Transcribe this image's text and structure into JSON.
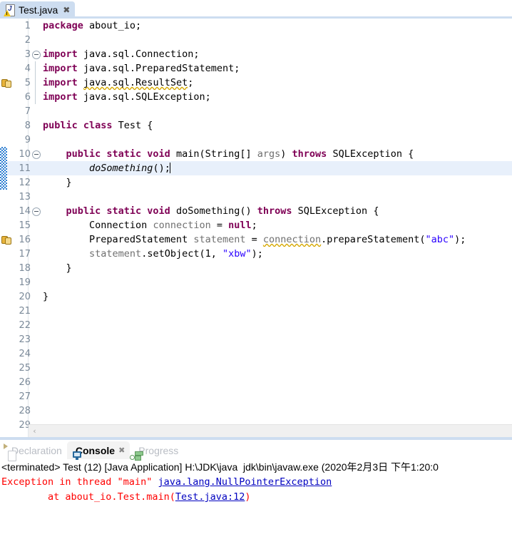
{
  "editor_tab": {
    "icon": "java-file-warning-icon",
    "label": "Test.java",
    "close": "✖"
  },
  "editor": {
    "scroll_left_arrow": "‹",
    "lines": [
      {
        "num": "1",
        "marker": null,
        "fold": null,
        "changed": false,
        "highlight": false
      },
      {
        "num": "2",
        "marker": null,
        "fold": null,
        "changed": false,
        "highlight": false
      },
      {
        "num": "3",
        "marker": null,
        "fold": "minus",
        "changed": false,
        "highlight": false
      },
      {
        "num": "4",
        "marker": null,
        "fold": "line",
        "changed": false,
        "highlight": false
      },
      {
        "num": "5",
        "marker": "warning",
        "fold": "line",
        "changed": false,
        "highlight": false
      },
      {
        "num": "6",
        "marker": null,
        "fold": "line",
        "changed": false,
        "highlight": false
      },
      {
        "num": "7",
        "marker": null,
        "fold": null,
        "changed": false,
        "highlight": false
      },
      {
        "num": "8",
        "marker": null,
        "fold": null,
        "changed": false,
        "highlight": false
      },
      {
        "num": "9",
        "marker": null,
        "fold": null,
        "changed": false,
        "highlight": false
      },
      {
        "num": "10",
        "marker": null,
        "fold": "minus",
        "changed": true,
        "highlight": false
      },
      {
        "num": "11",
        "marker": null,
        "fold": null,
        "changed": true,
        "highlight": true
      },
      {
        "num": "12",
        "marker": null,
        "fold": null,
        "changed": true,
        "highlight": false
      },
      {
        "num": "13",
        "marker": null,
        "fold": null,
        "changed": false,
        "highlight": false
      },
      {
        "num": "14",
        "marker": null,
        "fold": "minus",
        "changed": false,
        "highlight": false
      },
      {
        "num": "15",
        "marker": null,
        "fold": null,
        "changed": false,
        "highlight": false
      },
      {
        "num": "16",
        "marker": "warning",
        "fold": null,
        "changed": false,
        "highlight": false
      },
      {
        "num": "17",
        "marker": null,
        "fold": null,
        "changed": false,
        "highlight": false
      },
      {
        "num": "18",
        "marker": null,
        "fold": null,
        "changed": false,
        "highlight": false
      },
      {
        "num": "19",
        "marker": null,
        "fold": null,
        "changed": false,
        "highlight": false
      },
      {
        "num": "20",
        "marker": null,
        "fold": null,
        "changed": false,
        "highlight": false
      },
      {
        "num": "21",
        "marker": null,
        "fold": null,
        "changed": false,
        "highlight": false
      },
      {
        "num": "22",
        "marker": null,
        "fold": null,
        "changed": false,
        "highlight": false
      },
      {
        "num": "23",
        "marker": null,
        "fold": null,
        "changed": false,
        "highlight": false
      },
      {
        "num": "24",
        "marker": null,
        "fold": null,
        "changed": false,
        "highlight": false
      },
      {
        "num": "25",
        "marker": null,
        "fold": null,
        "changed": false,
        "highlight": false
      },
      {
        "num": "26",
        "marker": null,
        "fold": null,
        "changed": false,
        "highlight": false
      },
      {
        "num": "27",
        "marker": null,
        "fold": null,
        "changed": false,
        "highlight": false
      },
      {
        "num": "28",
        "marker": null,
        "fold": null,
        "changed": false,
        "highlight": false
      },
      {
        "num": "29",
        "marker": null,
        "fold": null,
        "changed": false,
        "highlight": false
      }
    ],
    "code": [
      [
        {
          "t": "package ",
          "c": "kw"
        },
        {
          "t": "about_io;",
          "c": ""
        }
      ],
      [],
      [
        {
          "t": "import ",
          "c": "kw"
        },
        {
          "t": "java.sql.Connection;",
          "c": ""
        }
      ],
      [
        {
          "t": "import ",
          "c": "kw"
        },
        {
          "t": "java.sql.PreparedStatement;",
          "c": ""
        }
      ],
      [
        {
          "t": "import ",
          "c": "kw"
        },
        {
          "t": "java.sql.ResultSet",
          "c": "sqg"
        },
        {
          "t": ";",
          "c": ""
        }
      ],
      [
        {
          "t": "import ",
          "c": "kw"
        },
        {
          "t": "java.sql.SQLException;",
          "c": ""
        }
      ],
      [],
      [
        {
          "t": "public class ",
          "c": "kw"
        },
        {
          "t": "Test {",
          "c": ""
        }
      ],
      [],
      [
        {
          "t": "    ",
          "c": ""
        },
        {
          "t": "public static void ",
          "c": "kw"
        },
        {
          "t": "main(String[] ",
          "c": ""
        },
        {
          "t": "args",
          "c": "param"
        },
        {
          "t": ") ",
          "c": ""
        },
        {
          "t": "throws ",
          "c": "kw"
        },
        {
          "t": "SQLException {",
          "c": ""
        }
      ],
      [
        {
          "t": "        ",
          "c": ""
        },
        {
          "t": "doSomething",
          "c": "mth"
        },
        {
          "t": "();",
          "c": ""
        }
      ],
      [
        {
          "t": "    }",
          "c": ""
        }
      ],
      [],
      [
        {
          "t": "    ",
          "c": ""
        },
        {
          "t": "public static void ",
          "c": "kw"
        },
        {
          "t": "doSomething() ",
          "c": ""
        },
        {
          "t": "throws ",
          "c": "kw"
        },
        {
          "t": "SQLException {",
          "c": ""
        }
      ],
      [
        {
          "t": "        Connection ",
          "c": ""
        },
        {
          "t": "connection",
          "c": "local"
        },
        {
          "t": " = ",
          "c": ""
        },
        {
          "t": "null",
          "c": "kw"
        },
        {
          "t": ";",
          "c": ""
        }
      ],
      [
        {
          "t": "        PreparedStatement ",
          "c": ""
        },
        {
          "t": "statement",
          "c": "local"
        },
        {
          "t": " = ",
          "c": ""
        },
        {
          "t": "connection",
          "c": "local sqg"
        },
        {
          "t": ".prepareStatement(",
          "c": ""
        },
        {
          "t": "\"abc\"",
          "c": "str"
        },
        {
          "t": ");",
          "c": ""
        }
      ],
      [
        {
          "t": "        ",
          "c": ""
        },
        {
          "t": "statement",
          "c": "local"
        },
        {
          "t": ".setObject(1, ",
          "c": ""
        },
        {
          "t": "\"xbw\"",
          "c": "str"
        },
        {
          "t": ");",
          "c": ""
        }
      ],
      [
        {
          "t": "    }",
          "c": ""
        }
      ],
      [],
      [
        {
          "t": "}",
          "c": ""
        }
      ],
      [],
      [],
      [],
      [],
      [],
      [],
      [],
      [],
      []
    ]
  },
  "bottom_view": {
    "tabs": [
      {
        "label": "Declaration",
        "icon": "declaration-icon",
        "active": false,
        "closable": false
      },
      {
        "label": "Console",
        "icon": "console-icon",
        "active": true,
        "closable": true,
        "close": "✖"
      },
      {
        "label": "Progress",
        "icon": "progress-icon",
        "active": false,
        "closable": false
      }
    ],
    "console": {
      "header": "<terminated> Test (12) [Java Application] H:\\JDK\\java  jdk\\bin\\javaw.exe (2020年2月3日 下午1:20:0",
      "lines": [
        [
          {
            "t": "Exception in thread \"main\" ",
            "c": ""
          },
          {
            "t": "java.lang.NullPointerException",
            "c": "link"
          }
        ],
        [
          {
            "t": "\tat about_io.Test.main(",
            "c": ""
          },
          {
            "t": "Test.java:12",
            "c": "link"
          },
          {
            "t": ")",
            "c": ""
          }
        ]
      ]
    }
  },
  "colors": {
    "keyword": "#7f0055",
    "string": "#2a00ff",
    "error": "#ff0000",
    "link": "#0000c0",
    "tab_active": "#cdddf0",
    "highlight_line": "#e8f0fb"
  }
}
